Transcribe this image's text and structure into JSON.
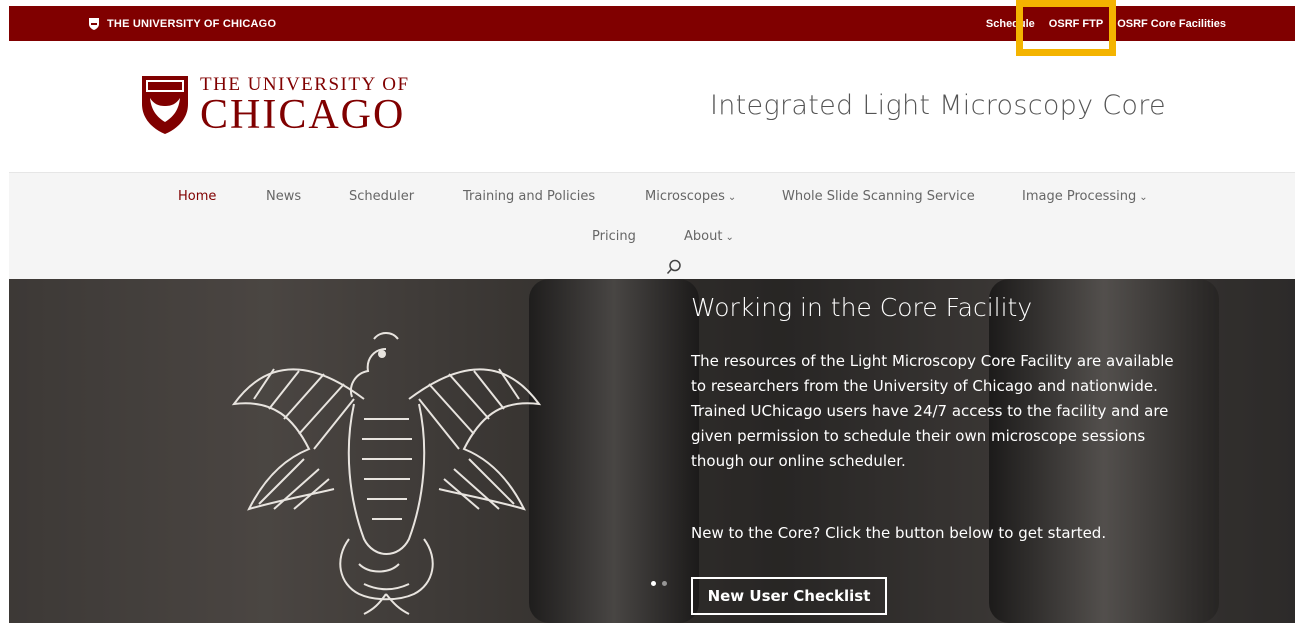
{
  "topbar": {
    "brand": "THE UNIVERSITY OF CHICAGO",
    "links": [
      "Schedule",
      "OSRF FTP",
      "OSRF Core Facilities"
    ]
  },
  "logo": {
    "line1": "THE UNIVERSITY OF",
    "line2": "CHICAGO"
  },
  "site_title": "Integrated Light Microscopy Core",
  "nav": {
    "row1": [
      "Home",
      "News",
      "Scheduler",
      "Training and Policies",
      "Microscopes",
      "Whole Slide Scanning Service",
      "Image Processing"
    ],
    "row2": [
      "Pricing",
      "About"
    ],
    "caret": "⌄"
  },
  "hero": {
    "title": "Working in the Core Facility",
    "body": "The resources of the Light Microscopy Core Facility are available to researchers from the University of Chicago and nationwide. Trained UChicago users have 24/7 access to the facility and are given permission to schedule their own microscope sessions though our online scheduler.",
    "cta": "New to the Core? Click the button below to get started.",
    "button": "New User Checklist"
  },
  "colors": {
    "maroon": "#800000",
    "highlight": "#f4b400"
  }
}
